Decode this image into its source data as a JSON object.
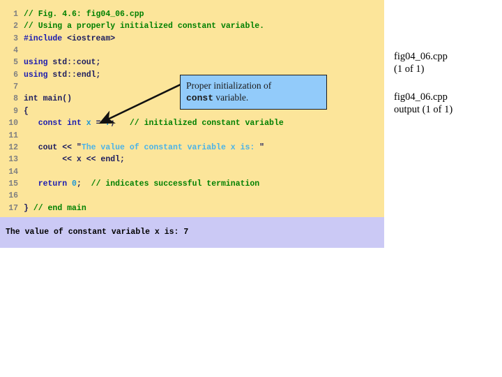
{
  "code_panel": {
    "name": "cpp-source-listing",
    "background": "#fce59a",
    "lines": [
      {
        "n": "1",
        "segments": [
          {
            "t": "// Fig. 4.6: fig04_06.cpp",
            "c": "c-comment"
          }
        ]
      },
      {
        "n": "2",
        "segments": [
          {
            "t": "// Using a properly initialized constant variable.",
            "c": "c-comment"
          }
        ]
      },
      {
        "n": "3",
        "segments": [
          {
            "t": "#include",
            "c": "c-pre"
          },
          {
            "t": " <iostream>",
            "c": "c-plain"
          }
        ]
      },
      {
        "n": "4",
        "segments": [
          {
            "t": "",
            "c": "c-plain"
          }
        ]
      },
      {
        "n": "5",
        "segments": [
          {
            "t": "using",
            "c": "c-keyword"
          },
          {
            "t": " std::cout;",
            "c": "c-plain"
          }
        ]
      },
      {
        "n": "6",
        "segments": [
          {
            "t": "using",
            "c": "c-keyword"
          },
          {
            "t": " std::endl;",
            "c": "c-plain"
          }
        ]
      },
      {
        "n": "7",
        "segments": [
          {
            "t": "",
            "c": "c-plain"
          }
        ]
      },
      {
        "n": "8",
        "segments": [
          {
            "t": "int",
            "c": "c-plain"
          },
          {
            "t": " main()",
            "c": "c-plain"
          }
        ]
      },
      {
        "n": "9",
        "segments": [
          {
            "t": "{",
            "c": "c-plain"
          }
        ]
      },
      {
        "n": "10",
        "segments": [
          {
            "t": "   ",
            "c": "c-plain"
          },
          {
            "t": "const",
            "c": "c-keyword"
          },
          {
            "t": " ",
            "c": "c-plain"
          },
          {
            "t": "int",
            "c": "c-keyword"
          },
          {
            "t": " ",
            "c": "c-plain"
          },
          {
            "t": "x",
            "c": "c-ident"
          },
          {
            "t": " = ",
            "c": "c-plain"
          },
          {
            "t": "7",
            "c": "c-num"
          },
          {
            "t": ";   ",
            "c": "c-plain"
          },
          {
            "t": "// initialized constant variable",
            "c": "c-comment"
          }
        ]
      },
      {
        "n": "11",
        "segments": [
          {
            "t": "",
            "c": "c-plain"
          }
        ]
      },
      {
        "n": "12",
        "segments": [
          {
            "t": "   cout << ",
            "c": "c-plain"
          },
          {
            "t": "\"",
            "c": "c-quote"
          },
          {
            "t": "The value of constant variable x is: ",
            "c": "c-str"
          },
          {
            "t": "\"",
            "c": "c-quote"
          }
        ]
      },
      {
        "n": "13",
        "segments": [
          {
            "t": "        << x << endl;",
            "c": "c-plain"
          }
        ]
      },
      {
        "n": "14",
        "segments": [
          {
            "t": "",
            "c": "c-plain"
          }
        ]
      },
      {
        "n": "15",
        "segments": [
          {
            "t": "   ",
            "c": "c-plain"
          },
          {
            "t": "return",
            "c": "c-keyword"
          },
          {
            "t": " ",
            "c": "c-plain"
          },
          {
            "t": "0",
            "c": "c-num"
          },
          {
            "t": ";  ",
            "c": "c-plain"
          },
          {
            "t": "// indicates successful termination",
            "c": "c-comment"
          }
        ]
      },
      {
        "n": "16",
        "segments": [
          {
            "t": "",
            "c": "c-plain"
          }
        ]
      },
      {
        "n": "17",
        "segments": [
          {
            "t": "} ",
            "c": "c-plain"
          },
          {
            "t": "// end main",
            "c": "c-comment"
          }
        ]
      }
    ]
  },
  "output_panel": {
    "background": "#cbc9f5",
    "text": "The value of constant variable x is: 7"
  },
  "callout": {
    "background": "#92cbfa",
    "border_color": "#1a1a1a",
    "line1": "Proper initialization of",
    "code_word": "const",
    "line2_tail": " variable."
  },
  "side_captions": {
    "file": "fig04_06.cpp\n(1 of 1)",
    "output": "fig04_06.cpp\noutput (1 of 1)"
  }
}
